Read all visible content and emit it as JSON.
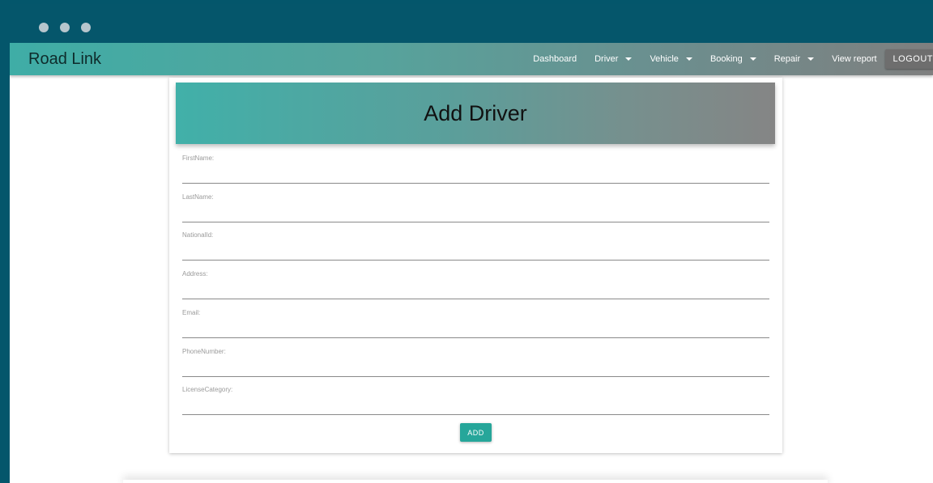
{
  "navbar": {
    "brand": "Road Link",
    "items": [
      {
        "label": "Dashboard",
        "dropdown": false
      },
      {
        "label": "Driver",
        "dropdown": true
      },
      {
        "label": "Vehicle",
        "dropdown": true
      },
      {
        "label": "Booking",
        "dropdown": true
      },
      {
        "label": "Repair",
        "dropdown": true
      },
      {
        "label": "View report",
        "dropdown": false
      }
    ],
    "logout_label": "LOGOUT"
  },
  "form": {
    "title": "Add Driver",
    "fields": [
      {
        "label": "FirstName:",
        "value": ""
      },
      {
        "label": "LastName:",
        "value": ""
      },
      {
        "label": "NationalId:",
        "value": ""
      },
      {
        "label": "Address:",
        "value": ""
      },
      {
        "label": "Email:",
        "value": ""
      },
      {
        "label": "PhoneNumber:",
        "value": ""
      },
      {
        "label": "LicenseCategory:",
        "value": ""
      }
    ],
    "submit_label": "ADD"
  },
  "colors": {
    "accent": "#26a69a",
    "chrome": "#05566b"
  }
}
